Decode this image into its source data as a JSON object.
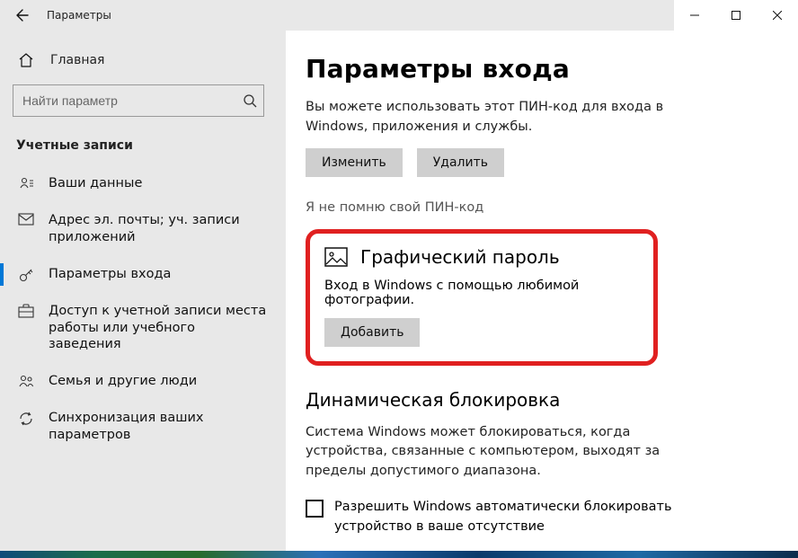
{
  "titlebar": {
    "title": "Параметры"
  },
  "sidebar": {
    "home_label": "Главная",
    "search_placeholder": "Найти параметр",
    "section_title": "Учетные записи",
    "items": [
      {
        "label": "Ваши данные"
      },
      {
        "label": "Адрес эл. почты; уч. записи приложений"
      },
      {
        "label": "Параметры входа"
      },
      {
        "label": "Доступ к учетной записи места работы или учебного заведения"
      },
      {
        "label": "Семья и другие люди"
      },
      {
        "label": "Синхронизация ваших параметров"
      }
    ]
  },
  "content": {
    "page_heading": "Параметры входа",
    "pin_desc": "Вы можете использовать этот ПИН-код для входа в Windows, приложения и службы.",
    "change_label": "Изменить",
    "delete_label": "Удалить",
    "forgot_pin": "Я не помню свой ПИН-код",
    "picture_password": {
      "heading": "Графический пароль",
      "desc": "Вход в Windows с помощью любимой фотографии.",
      "add_label": "Добавить"
    },
    "dynamic_lock": {
      "heading": "Динамическая блокировка",
      "desc": "Система Windows может блокироваться, когда устройства, связанные с компьютером, выходят за пределы допустимого диапазона.",
      "checkbox_label": "Разрешить Windows автоматически блокировать устройство в ваше отсутствие"
    }
  }
}
